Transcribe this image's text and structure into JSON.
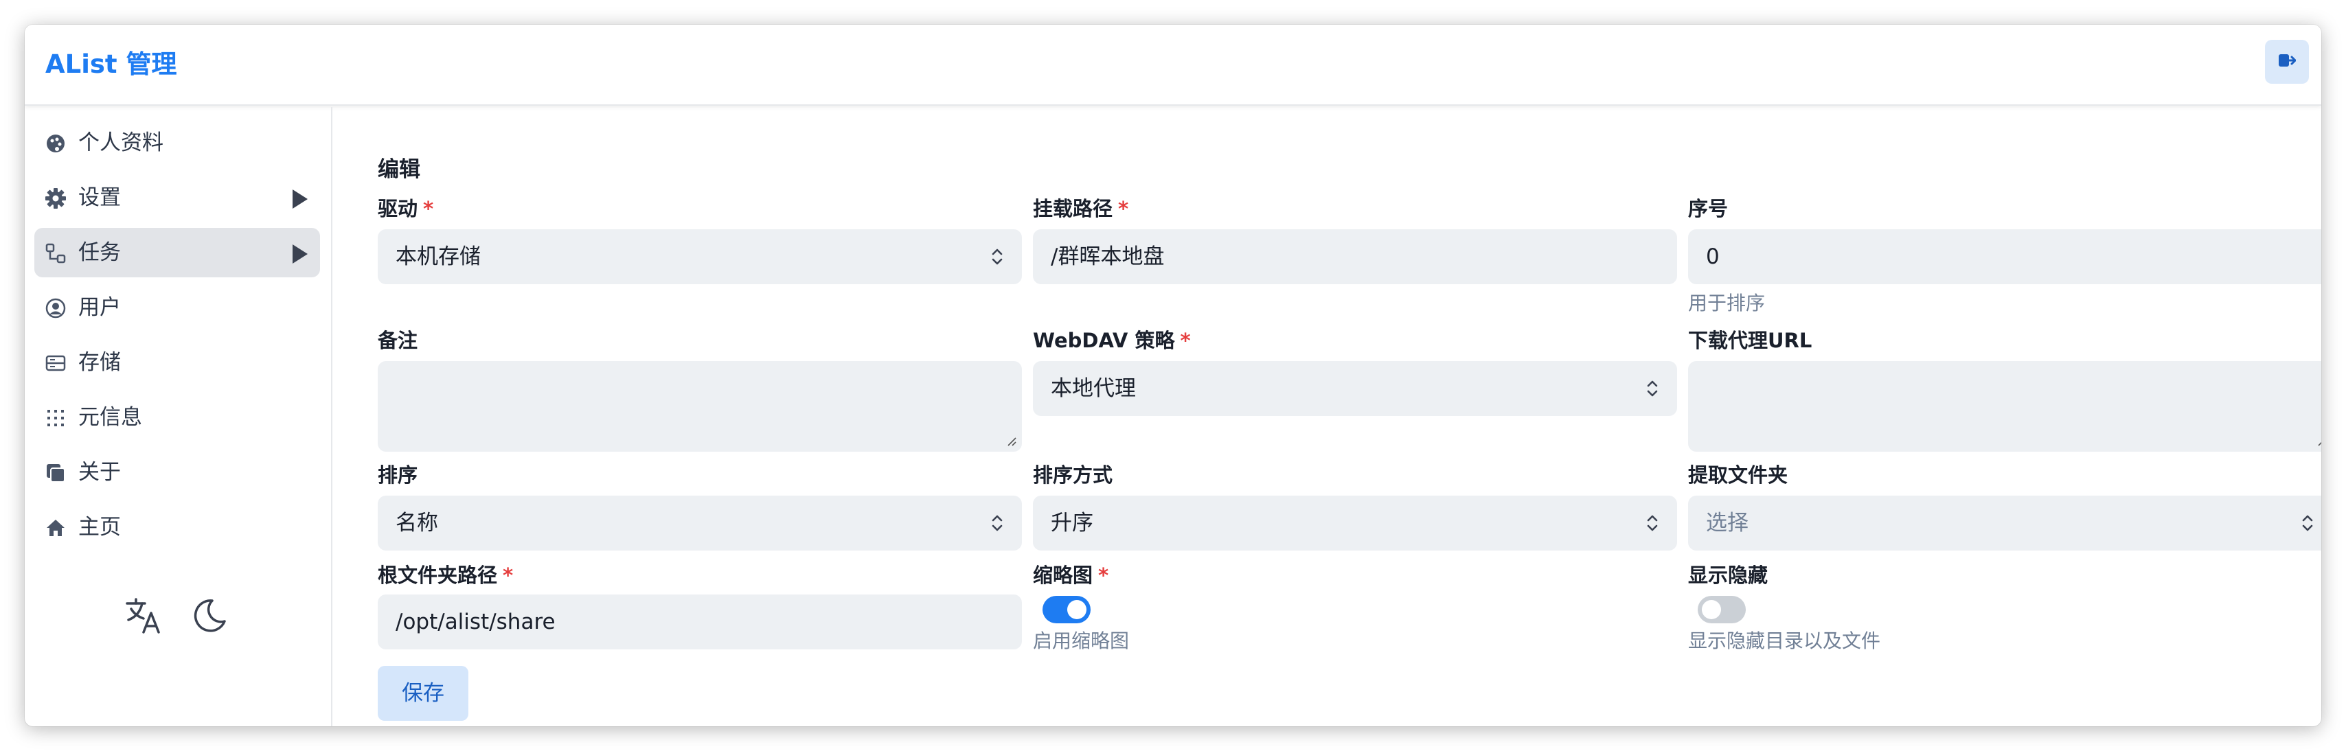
{
  "header": {
    "title": "AList 管理",
    "logout_icon": "logout-icon"
  },
  "sidebar": {
    "items": [
      {
        "label": "个人资料",
        "icon": "profile-icon"
      },
      {
        "label": "设置",
        "icon": "gear-icon",
        "expandable": true
      },
      {
        "label": "任务",
        "icon": "tasks-icon",
        "expandable": true,
        "active": true
      },
      {
        "label": "用户",
        "icon": "user-icon"
      },
      {
        "label": "存储",
        "icon": "storage-icon"
      },
      {
        "label": "元信息",
        "icon": "meta-icon"
      },
      {
        "label": "关于",
        "icon": "about-icon"
      },
      {
        "label": "主页",
        "icon": "home-icon"
      }
    ],
    "tools": [
      "translate-icon",
      "dark-mode-icon"
    ]
  },
  "form": {
    "title": "编辑",
    "driver": {
      "label": "驱动",
      "required": "*",
      "value": "本机存储"
    },
    "mount_path": {
      "label": "挂载路径",
      "required": "*",
      "value": "/群晖本地盘"
    },
    "order": {
      "label": "序号",
      "value": "0",
      "help": "用于排序"
    },
    "remark": {
      "label": "备注",
      "value": ""
    },
    "webdav_policy": {
      "label": "WebDAV 策略",
      "required": "*",
      "value": "本地代理"
    },
    "download_proxy_url": {
      "label": "下载代理URL",
      "value": ""
    },
    "order_by": {
      "label": "排序",
      "value": "名称"
    },
    "order_direction": {
      "label": "排序方式",
      "value": "升序"
    },
    "extract_folder": {
      "label": "提取文件夹",
      "placeholder": "选择"
    },
    "root_folder_path": {
      "label": "根文件夹路径",
      "required": "*",
      "value": "/opt/alist/share"
    },
    "thumbnail": {
      "label": "缩略图",
      "required": "*",
      "enabled": true,
      "help": "启用缩略图"
    },
    "show_hidden": {
      "label": "显示隐藏",
      "enabled": false,
      "help": "显示隐藏目录以及文件"
    },
    "save_label": "保存"
  },
  "colors": {
    "accent": "#1e7cf2",
    "required": "#e53e3e",
    "input_bg": "#edf0f3",
    "active_nav": "#e2e4e8"
  }
}
